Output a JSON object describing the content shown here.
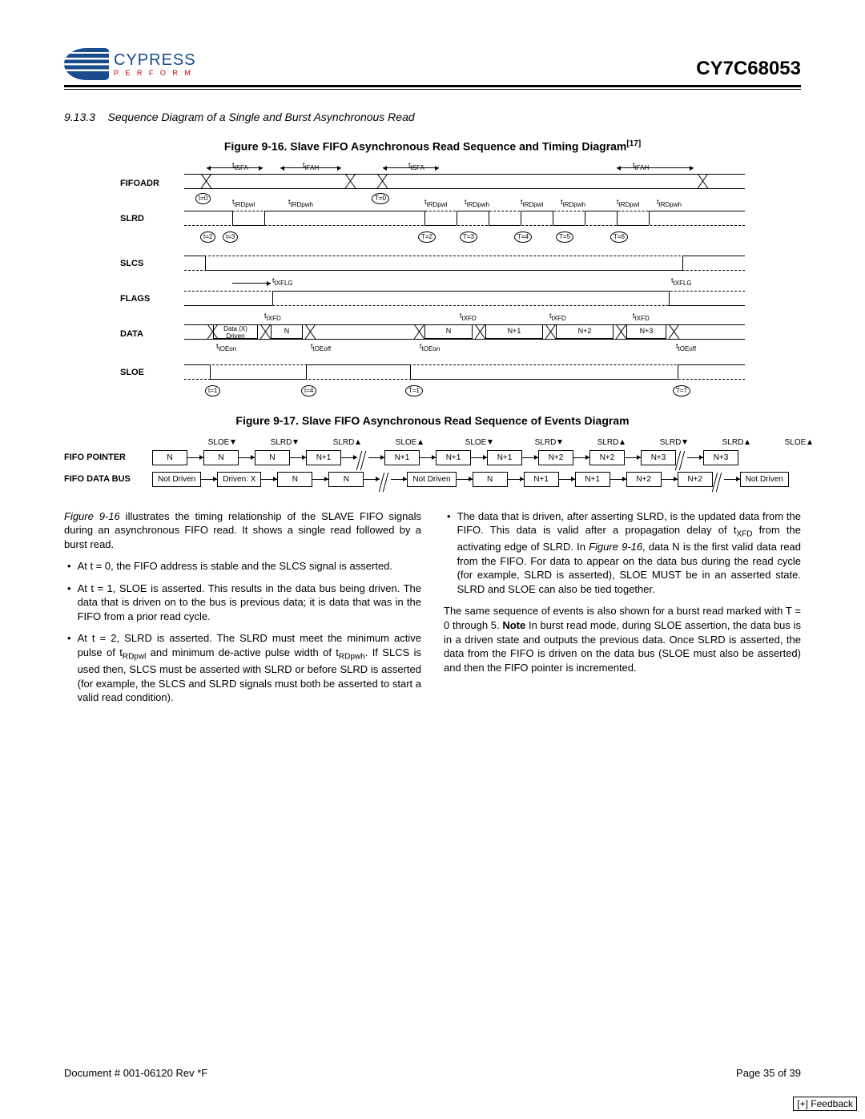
{
  "header": {
    "logo_name": "CYPRESS",
    "logo_tagline": "P E R F O R M",
    "part_number": "CY7C68053"
  },
  "section": {
    "number": "9.13.3",
    "title": "Sequence Diagram of a Single and Burst Asynchronous Read"
  },
  "fig16": {
    "title": "Figure 9-16. Slave FIFO Asynchronous Read Sequence and Timing Diagram",
    "ref": "[17]",
    "signals": [
      "FIFOADR",
      "SLRD",
      "SLCS",
      "FLAGS",
      "DATA",
      "SLOE"
    ],
    "timing_labels": {
      "tSFA": "tSFA",
      "tFAH": "tFAH",
      "tRDpwl": "tRDpwl",
      "tRDpwh": "tRDpwh",
      "tXFLG": "tXFLG",
      "tXFD": "tXFD",
      "tOEon": "tOEon",
      "tOEoff": "tOEoff"
    },
    "t_markers_single": [
      "t=0",
      "t=1",
      "t=2",
      "t=3",
      "t=4"
    ],
    "t_markers_burst": [
      "T=0",
      "T=1",
      "T=2",
      "T=3",
      "T=4",
      "T=5",
      "T=6",
      "T=7"
    ],
    "data_values": {
      "driven": "Data (X) Driven",
      "n": "N",
      "n1": "N+1",
      "n2": "N+2",
      "n3": "N+3"
    }
  },
  "fig17": {
    "title": "Figure 9-17. Slave FIFO Asynchronous Read Sequence of Events Diagram",
    "header_events": [
      {
        "label": "SLOE",
        "dir": "down"
      },
      {
        "label": "SLRD",
        "dir": "down"
      },
      {
        "label": "SLRD",
        "dir": "up"
      },
      {
        "label": "SLOE",
        "dir": "up"
      },
      {
        "label": "SLOE",
        "dir": "down"
      },
      {
        "label": "SLRD",
        "dir": "down"
      },
      {
        "label": "SLRD",
        "dir": "up"
      },
      {
        "label": "SLRD",
        "dir": "down"
      },
      {
        "label": "SLRD",
        "dir": "up"
      },
      {
        "label": "SLOE",
        "dir": "up"
      }
    ],
    "rows": [
      {
        "label": "FIFO POINTER",
        "cells": [
          "N",
          "N",
          "N",
          "N+1",
          "N+1",
          "N+1",
          "N+1",
          "N+2",
          "N+2",
          "N+3",
          "N+3"
        ]
      },
      {
        "label": "FIFO DATA BUS",
        "cells": [
          "Not Driven",
          "Driven: X",
          "N",
          "N",
          "Not Driven",
          "N",
          "N+1",
          "N+1",
          "N+2",
          "N+2",
          "Not Driven"
        ]
      }
    ]
  },
  "body": {
    "p1a": "Figure 9-16",
    "p1b": " illustrates the timing relationship of the SLAVE FIFO signals during an asynchronous FIFO read. It shows a single read followed by a burst read.",
    "b1": "At  t = 0, the FIFO address is stable and the SLCS signal is asserted.",
    "b2": "At  t = 1, SLOE is asserted. This results in the data bus being driven. The data that is driven on to the bus is previous data; it is data that was in the FIFO from a prior read cycle.",
    "b3a": "At  t = 2, SLRD is asserted. The SLRD must meet the minimum active pulse of t",
    "b3b": " and minimum de-active pulse width of t",
    "b3c": ". If SLCS is used then, SLCS must be asserted with SLRD or before SLRD is asserted (for example, the SLCS and SLRD signals must both be asserted to start a valid read condition).",
    "b4a": "The data that is driven, after asserting SLRD, is the updated data from the FIFO. This data is valid after a propagation delay of t",
    "b4b": " from the activating edge of SLRD. In ",
    "b4c": "Figure 9-16",
    "b4d": ", data N is the first valid data read from the FIFO. For data to appear on the data bus during the read cycle (for example, SLRD is asserted), SLOE MUST be in an asserted state. SLRD and SLOE can also be tied together.",
    "p2a": "The same sequence of events is also shown for a burst read marked with T = 0 through 5. ",
    "p2note": "Note",
    "p2b": " In burst read mode, during SLOE assertion, the data bus is in a driven state and outputs the previous data. Once SLRD is asserted, the data from the FIFO is driven on the data bus (SLOE must also be asserted) and then the FIFO pointer is incremented.",
    "sub_RDpwl": "RDpwl",
    "sub_RDpwh": "RDpwh",
    "sub_XFD": "XFD"
  },
  "footer": {
    "doc": "Document # 001-06120 Rev *F",
    "page": "Page 35 of 39",
    "feedback": "[+] Feedback"
  }
}
